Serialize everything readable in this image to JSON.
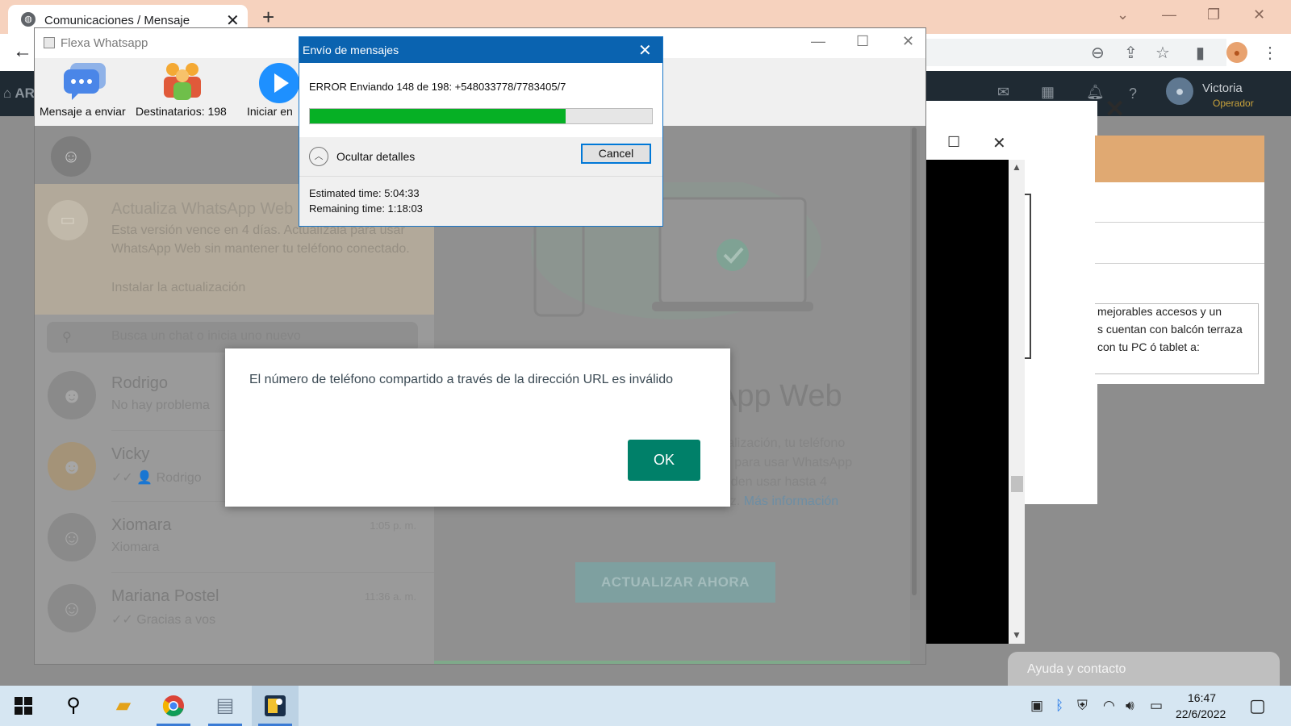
{
  "browser": {
    "tab_title": "Comunicaciones / Mensaje",
    "tab_icon": "globe-icon",
    "new_tab_glyph": "+",
    "tab_close_glyph": "✕"
  },
  "webapp": {
    "user_name": "Victoria",
    "user_role": "Operador",
    "panel_text": "mejorables accesos y un\ns cuentan con balcón terraza\ncon tu PC ó tablet a:",
    "help_label": "Ayuda y contacto"
  },
  "flexa": {
    "title": "Flexa Whatsapp",
    "toolbar": {
      "message_label": "Mensaje a enviar",
      "recipients_label": "Destinatarios: 198",
      "start_label": "Iniciar en"
    }
  },
  "whatsapp": {
    "banner_title": "Actualiza WhatsApp Web",
    "banner_body": "Esta versión vence en 4 días. Actualízala para usar WhatsApp Web sin mantener tu teléfono conectado.",
    "banner_link": "Instalar la actualización",
    "search_placeholder": "Busca un chat o inicia uno nuevo",
    "chats": [
      {
        "name": "Rodrigo",
        "preview": "No hay problema",
        "time": ""
      },
      {
        "name": "Vicky",
        "preview": "✓✓ 👤 Rodrigo",
        "time": ""
      },
      {
        "name": "Xiomara",
        "preview": "Xiomara",
        "time": "1:05 p. m."
      },
      {
        "name": "Mariana Postel",
        "preview": "✓✓ Gracias a vos",
        "time": "11:36 a. m."
      }
    ],
    "hero_title": "App Web",
    "hero_body_1": "tualización, tu teléfono",
    "hero_body_2": "do para usar WhatsApp",
    "hero_body_3": "ueden usar hasta 4",
    "hero_body_4": "vez.",
    "hero_link": "Más información",
    "update_button": "ACTUALIZAR AHORA"
  },
  "progress_dialog": {
    "title": "Envío de mensajes",
    "status": "ERROR Enviando 148 de 198: +548033778/7783405/7",
    "progress_fraction": 0.7475,
    "details_label": "Ocultar detalles",
    "cancel_label": "Cancel",
    "estimated_time": "Estimated time: 5:04:33",
    "remaining_time": "Remaining time: 1:18:03"
  },
  "alert": {
    "message": "El número de teléfono compartido a través de la dirección URL es inválido",
    "ok_label": "OK"
  },
  "taskbar": {
    "time": "16:47",
    "date": "22/6/2022"
  },
  "colors": {
    "chrome_tabbar": "#f6d2be",
    "dialog_title": "#0a63b0",
    "progress_green": "#06b025",
    "whatsapp_ok": "#008069",
    "taskbar": "#d6e6f2"
  }
}
